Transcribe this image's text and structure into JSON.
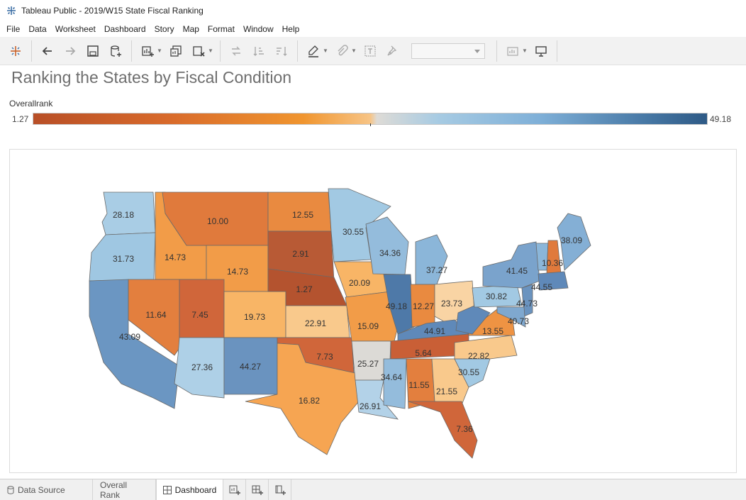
{
  "window": {
    "title": "Tableau Public - 2019/W15 State Fiscal Ranking"
  },
  "menu": [
    "File",
    "Data",
    "Worksheet",
    "Dashboard",
    "Story",
    "Map",
    "Format",
    "Window",
    "Help"
  ],
  "toolbar": {
    "icons": [
      "tableau-logo-icon",
      "undo-icon",
      "redo-icon",
      "save-icon",
      "new-data-source-icon",
      "new-worksheet-icon",
      "duplicate-sheet-icon",
      "clear-sheet-icon",
      "swap-rows-columns-icon",
      "sort-ascending-icon",
      "sort-descending-icon",
      "highlight-icon",
      "group-icon",
      "show-labels-icon",
      "fix-axes-icon",
      "fit-dropdown",
      "show-me-icon",
      "presentation-mode-icon"
    ]
  },
  "dashboard": {
    "title": "Ranking the States by Fiscal Condition",
    "legend": {
      "label": "Overallrank",
      "min": "1.27",
      "max": "49.18",
      "colors": {
        "low": "#b84f27",
        "mid": "#dedbd6",
        "high": "#2e5a86"
      }
    }
  },
  "map": {
    "states": [
      {
        "abbr": "WA",
        "value": "28.18",
        "color": "#a9cde5"
      },
      {
        "abbr": "OR",
        "value": "31.73",
        "color": "#9fc7e2"
      },
      {
        "abbr": "CA",
        "value": "43.09",
        "color": "#6b96c2"
      },
      {
        "abbr": "ID",
        "value": "14.73",
        "color": "#f29c48"
      },
      {
        "abbr": "NV",
        "value": "11.64",
        "color": "#e37f3e"
      },
      {
        "abbr": "MT",
        "value": "10.00",
        "color": "#e07a3c"
      },
      {
        "abbr": "WY",
        "value": "14.73",
        "color": "#f29c48"
      },
      {
        "abbr": "UT",
        "value": "7.45",
        "color": "#d0663a"
      },
      {
        "abbr": "AZ",
        "value": "27.36",
        "color": "#aed0e7"
      },
      {
        "abbr": "CO",
        "value": "19.73",
        "color": "#f8b566"
      },
      {
        "abbr": "NM",
        "value": "44.27",
        "color": "#6a93bf"
      },
      {
        "abbr": "ND",
        "value": "12.55",
        "color": "#e98a40"
      },
      {
        "abbr": "SD",
        "value": "2.91",
        "color": "#b85a35"
      },
      {
        "abbr": "NE",
        "value": "1.27",
        "color": "#b4532f"
      },
      {
        "abbr": "KS",
        "value": "22.91",
        "color": "#f9c98c"
      },
      {
        "abbr": "OK",
        "value": "7.73",
        "color": "#d0663a"
      },
      {
        "abbr": "TX",
        "value": "16.82",
        "color": "#f6a552"
      },
      {
        "abbr": "MN",
        "value": "30.55",
        "color": "#a2c9e3"
      },
      {
        "abbr": "IA",
        "value": "20.09",
        "color": "#f8b566"
      },
      {
        "abbr": "MO",
        "value": "15.09",
        "color": "#f29c48"
      },
      {
        "abbr": "AR",
        "value": "25.27",
        "color": "#dcdad6"
      },
      {
        "abbr": "LA",
        "value": "26.91",
        "color": "#b3d2e8"
      },
      {
        "abbr": "WI",
        "value": "34.36",
        "color": "#94bcdc"
      },
      {
        "abbr": "IL",
        "value": "49.18",
        "color": "#4e79a8"
      },
      {
        "abbr": "MI",
        "value": "37.27",
        "color": "#8bb6d9"
      },
      {
        "abbr": "IN",
        "value": "12.27",
        "color": "#e98a40"
      },
      {
        "abbr": "OH",
        "value": "23.73",
        "color": "#f9d4a4"
      },
      {
        "abbr": "KY",
        "value": "44.91",
        "color": "#5f89b9"
      },
      {
        "abbr": "TN",
        "value": "5.64",
        "color": "#c95f36"
      },
      {
        "abbr": "MS",
        "value": "34.64",
        "color": "#94bcdc"
      },
      {
        "abbr": "AL",
        "value": "11.55",
        "color": "#e37f3e"
      },
      {
        "abbr": "GA",
        "value": "21.55",
        "color": "#f9c98c"
      },
      {
        "abbr": "FL",
        "value": "7.36",
        "color": "#d0663a"
      },
      {
        "abbr": "SC",
        "value": "30.55",
        "color": "#a2c9e3"
      },
      {
        "abbr": "NC",
        "value": "22.82",
        "color": "#f9c98c"
      },
      {
        "abbr": "VA",
        "value": "13.55",
        "color": "#ee9343"
      },
      {
        "abbr": "WV",
        "value": "",
        "color": "#5f89b9"
      },
      {
        "abbr": "PA",
        "value": "30.82",
        "color": "#a2c9e3"
      },
      {
        "abbr": "NY",
        "value": "41.45",
        "color": "#7aa3cc"
      },
      {
        "abbr": "NJ",
        "value": "44.73",
        "color": "#6a93bf"
      },
      {
        "abbr": "MD",
        "value": "40.73",
        "color": "#7fa8cf"
      },
      {
        "abbr": "VT",
        "value": "",
        "color": "#8bb6d9"
      },
      {
        "abbr": "NH",
        "value": "10.36",
        "color": "#e07a3c"
      },
      {
        "abbr": "ME",
        "value": "38.09",
        "color": "#84afd5"
      },
      {
        "abbr": "MA",
        "value": "44.55",
        "color": "#5f89b9"
      }
    ]
  },
  "tabs": {
    "data_source": "Data Source",
    "overall_rank": "Overall Rank",
    "dashboard": "Dashboard"
  }
}
